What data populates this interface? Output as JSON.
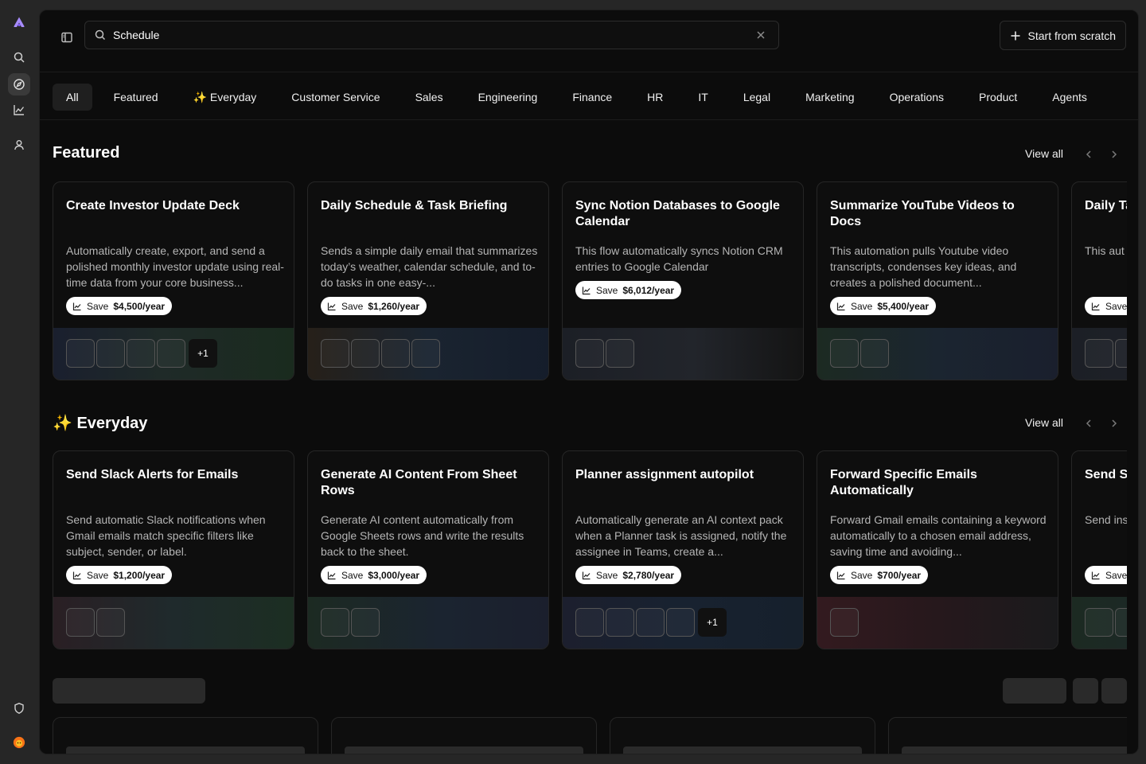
{
  "search": {
    "value": "Schedule",
    "placeholder": "Search"
  },
  "header": {
    "start_label": "Start from scratch"
  },
  "tabs": [
    "All",
    "Featured",
    "✨ Everyday",
    "Customer Service",
    "Sales",
    "Engineering",
    "Finance",
    "HR",
    "IT",
    "Legal",
    "Marketing",
    "Operations",
    "Product",
    "Agents"
  ],
  "featured": {
    "title": "Featured",
    "view_all": "View all",
    "cards": [
      {
        "title": "Create Investor Update Deck",
        "desc": "Automatically create, export, and send a polished monthly investor update using real-time data from your core business...",
        "save": "Save",
        "amount": "$4,500/year",
        "apps": 4,
        "more": "+1"
      },
      {
        "title": "Daily Schedule & Task Briefing",
        "desc": "Sends a simple daily email that summarizes today’s weather, calendar schedule, and to-do tasks in one easy-...",
        "save": "Save",
        "amount": "$1,260/year",
        "apps": 4,
        "more": ""
      },
      {
        "title": "Sync Notion Databases to Google Calendar",
        "desc": "This flow automatically syncs Notion CRM entries to Google Calendar",
        "save": "Save",
        "amount": "$6,012/year",
        "apps": 2,
        "more": ""
      },
      {
        "title": "Summarize YouTube Videos to Docs",
        "desc": "This automation pulls Youtube video transcripts, condenses key ideas, and creates a polished document...",
        "save": "Save",
        "amount": "$5,400/year",
        "apps": 2,
        "more": ""
      },
      {
        "title": "Daily Ta",
        "desc": "This aut tasks fro Sheets e",
        "save": "Save",
        "amount": "",
        "apps": 2,
        "more": ""
      }
    ]
  },
  "everyday": {
    "title": "✨ Everyday",
    "view_all": "View all",
    "cards": [
      {
        "title": "Send Slack Alerts for Emails",
        "desc": "Send automatic Slack notifications when Gmail emails match specific filters like subject, sender, or label.",
        "save": "Save",
        "amount": "$1,200/year",
        "apps": 2,
        "more": ""
      },
      {
        "title": "Generate AI Content From Sheet Rows",
        "desc": "Generate AI content automatically from Google Sheets rows and write the results back to the sheet.",
        "save": "Save",
        "amount": "$3,000/year",
        "apps": 2,
        "more": ""
      },
      {
        "title": "Planner assignment autopilot",
        "desc": "Automatically generate an AI context pack when a Planner task is assigned, notify the assignee in Teams, create a...",
        "save": "Save",
        "amount": "$2,780/year",
        "apps": 4,
        "more": "+1"
      },
      {
        "title": "Forward Specific Emails Automatically",
        "desc": "Forward Gmail emails containing a keyword automatically to a chosen email address, saving time and avoiding...",
        "save": "Save",
        "amount": "$700/year",
        "apps": 1,
        "more": ""
      },
      {
        "title": "Send S",
        "desc": "Send ins every ne your tea",
        "save": "Save",
        "amount": "",
        "apps": 2,
        "more": ""
      }
    ]
  },
  "colors": {
    "accent": "#a78bfa",
    "badge_bg": "#ffffff",
    "panel_bg": "#0c0c0c"
  },
  "icons": [
    "logo-icon",
    "search-icon",
    "compass-icon",
    "chart-icon",
    "user-icon",
    "shield-icon",
    "avatar"
  ]
}
